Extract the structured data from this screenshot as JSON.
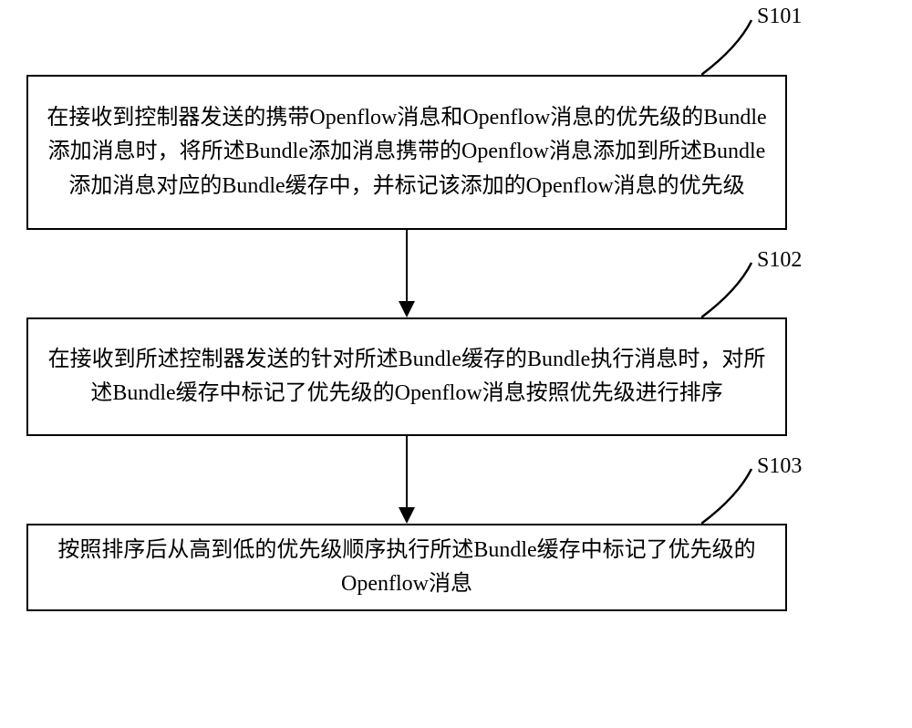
{
  "diagram": {
    "steps": [
      {
        "id": "S101",
        "label": "S101",
        "text": "在接收到控制器发送的携带Openflow消息和Openflow消息的优先级的Bundle添加消息时，将所述Bundle添加消息携带的Openflow消息添加到所述Bundle添加消息对应的Bundle缓存中，并标记该添加的Openflow消息的优先级"
      },
      {
        "id": "S102",
        "label": "S102",
        "text": "在接收到所述控制器发送的针对所述Bundle缓存的Bundle执行消息时，对所述Bundle缓存中标记了优先级的Openflow消息按照优先级进行排序"
      },
      {
        "id": "S103",
        "label": "S103",
        "text": "按照排序后从高到低的优先级顺序执行所述Bundle缓存中标记了优先级的Openflow消息"
      }
    ]
  }
}
